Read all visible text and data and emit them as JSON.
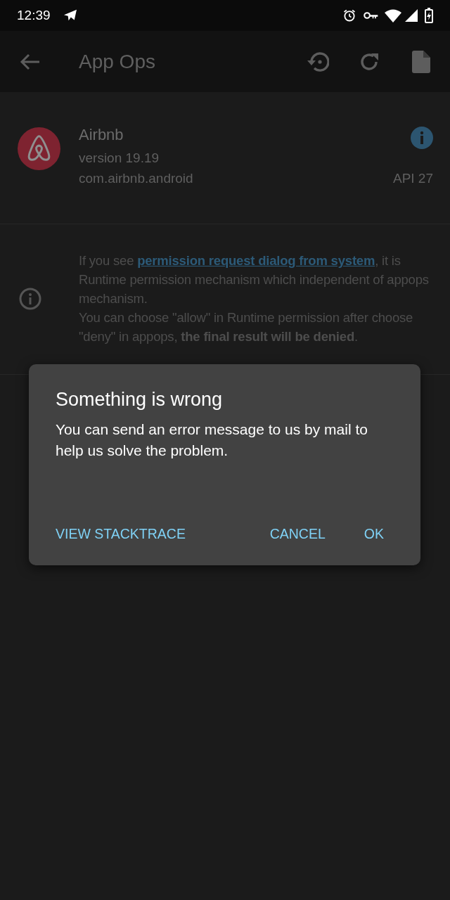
{
  "status_bar": {
    "time": "12:39"
  },
  "toolbar": {
    "title": "App Ops"
  },
  "app": {
    "name": "Airbnb",
    "version": "version 19.19",
    "package": "com.airbnb.android",
    "api": "API 27"
  },
  "notice": {
    "parts": [
      {
        "kind": "text",
        "text": "If you see "
      },
      {
        "kind": "link",
        "text": "permission request dialog from system"
      },
      {
        "kind": "text",
        "text": ", it is Runtime permission mechanism which independent of appops mechanism."
      }
    ],
    "second": "You can choose \"allow\" in Runtime permission after choose \"deny\" in appops, **the final result will be denied**."
  },
  "dialog": {
    "title": "Something is wrong",
    "message": "You can send an error message to us by mail to help us solve the problem.",
    "buttons": [
      "VIEW STACKTRACE",
      "CANCEL",
      "OK"
    ]
  }
}
